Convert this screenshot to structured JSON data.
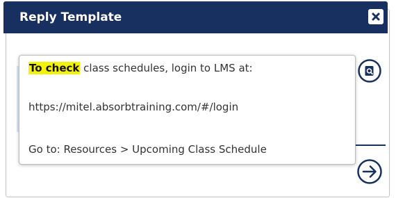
{
  "dialog": {
    "title": "Reply Template",
    "close_icon": "close-icon"
  },
  "editor": {
    "highlight_text": "To check",
    "line1_rest": " class schedules, login to LMS at:",
    "line2": "https://mitel.absorbtraining.com/#/login",
    "line3": "Go to: Resources > Upcoming Class Schedule"
  },
  "side_actions": {
    "copy_icon": "copy-search-icon",
    "next_icon": "arrow-right-circle-icon"
  },
  "colors": {
    "title_bar": "#17305f",
    "highlight": "#f5f20a",
    "icon_stroke": "#17305f"
  }
}
